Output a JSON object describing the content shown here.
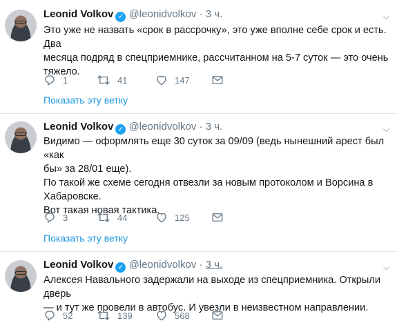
{
  "tweets": [
    {
      "name": "Leonid Volkov",
      "handle": "@leonidvolkov",
      "dot": "·",
      "time": "3 ч.",
      "lines": [
        "Это уже не назвать «срок в рассрочку», это уже вполне себе срок и есть. Два",
        "месяца подряд в спецприемнике, рассчитанном на 5-7 суток — это очень",
        "тяжело."
      ],
      "replies": "1",
      "retweets": "41",
      "likes": "147",
      "show_thread": "Показать эту ветку"
    },
    {
      "name": "Leonid Volkov",
      "handle": "@leonidvolkov",
      "dot": "·",
      "time": "3 ч.",
      "lines": [
        "Видимо — оформлять еще 30 суток за 09/09 (ведь нынешний арест был «как",
        "бы» за 28/01 еще).",
        "По такой же схеме сегодня отвезли за новым протоколом и Ворсина в",
        "Хабаровске.",
        "Вот такая новая тактика."
      ],
      "replies": "3",
      "retweets": "44",
      "likes": "125",
      "show_thread": "Показать эту ветку"
    },
    {
      "name": "Leonid Volkov",
      "handle": "@leonidvolkov",
      "dot": "·",
      "time": "3 ч.",
      "lines": [
        "Алексея Навального задержали на выходе из спецприемника. Открыли дверь",
        "— и тут же провели в автобус. И увезли в неизвестном направлении."
      ],
      "replies": "52",
      "retweets": "139",
      "likes": "568"
    }
  ],
  "verified_glyph": "✓",
  "chevron_glyph": "⌵",
  "colors": {
    "accent": "#1b95e0",
    "muted": "#657786",
    "verified": "#1da1f2",
    "divider": "#e1e8ed"
  }
}
